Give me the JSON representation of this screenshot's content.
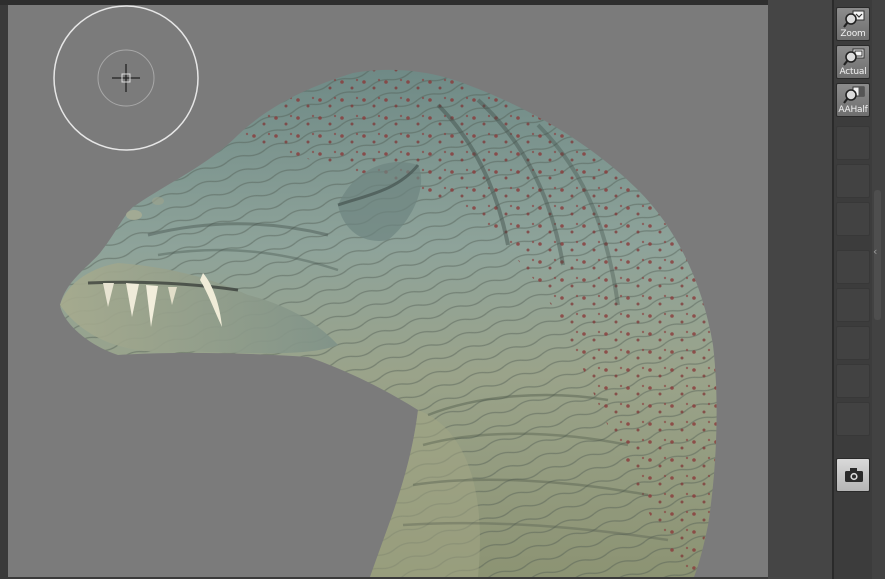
{
  "toolbar": {
    "buttons": [
      {
        "id": "zoom",
        "label": "Zoom",
        "icon": "zoom-magnifier-icon"
      },
      {
        "id": "actual",
        "label": "Actual",
        "icon": "actual-size-magnifier-icon"
      },
      {
        "id": "aahalf",
        "label": "AAHalf",
        "icon": "aa-half-magnifier-icon"
      }
    ],
    "camera_icon": "camera-icon"
  },
  "canvas": {
    "background_color": "#7b7b7b",
    "subject": "sculpted-creature-head"
  },
  "brush_cursor_icon": "brush-cursor-crosshair-icon"
}
